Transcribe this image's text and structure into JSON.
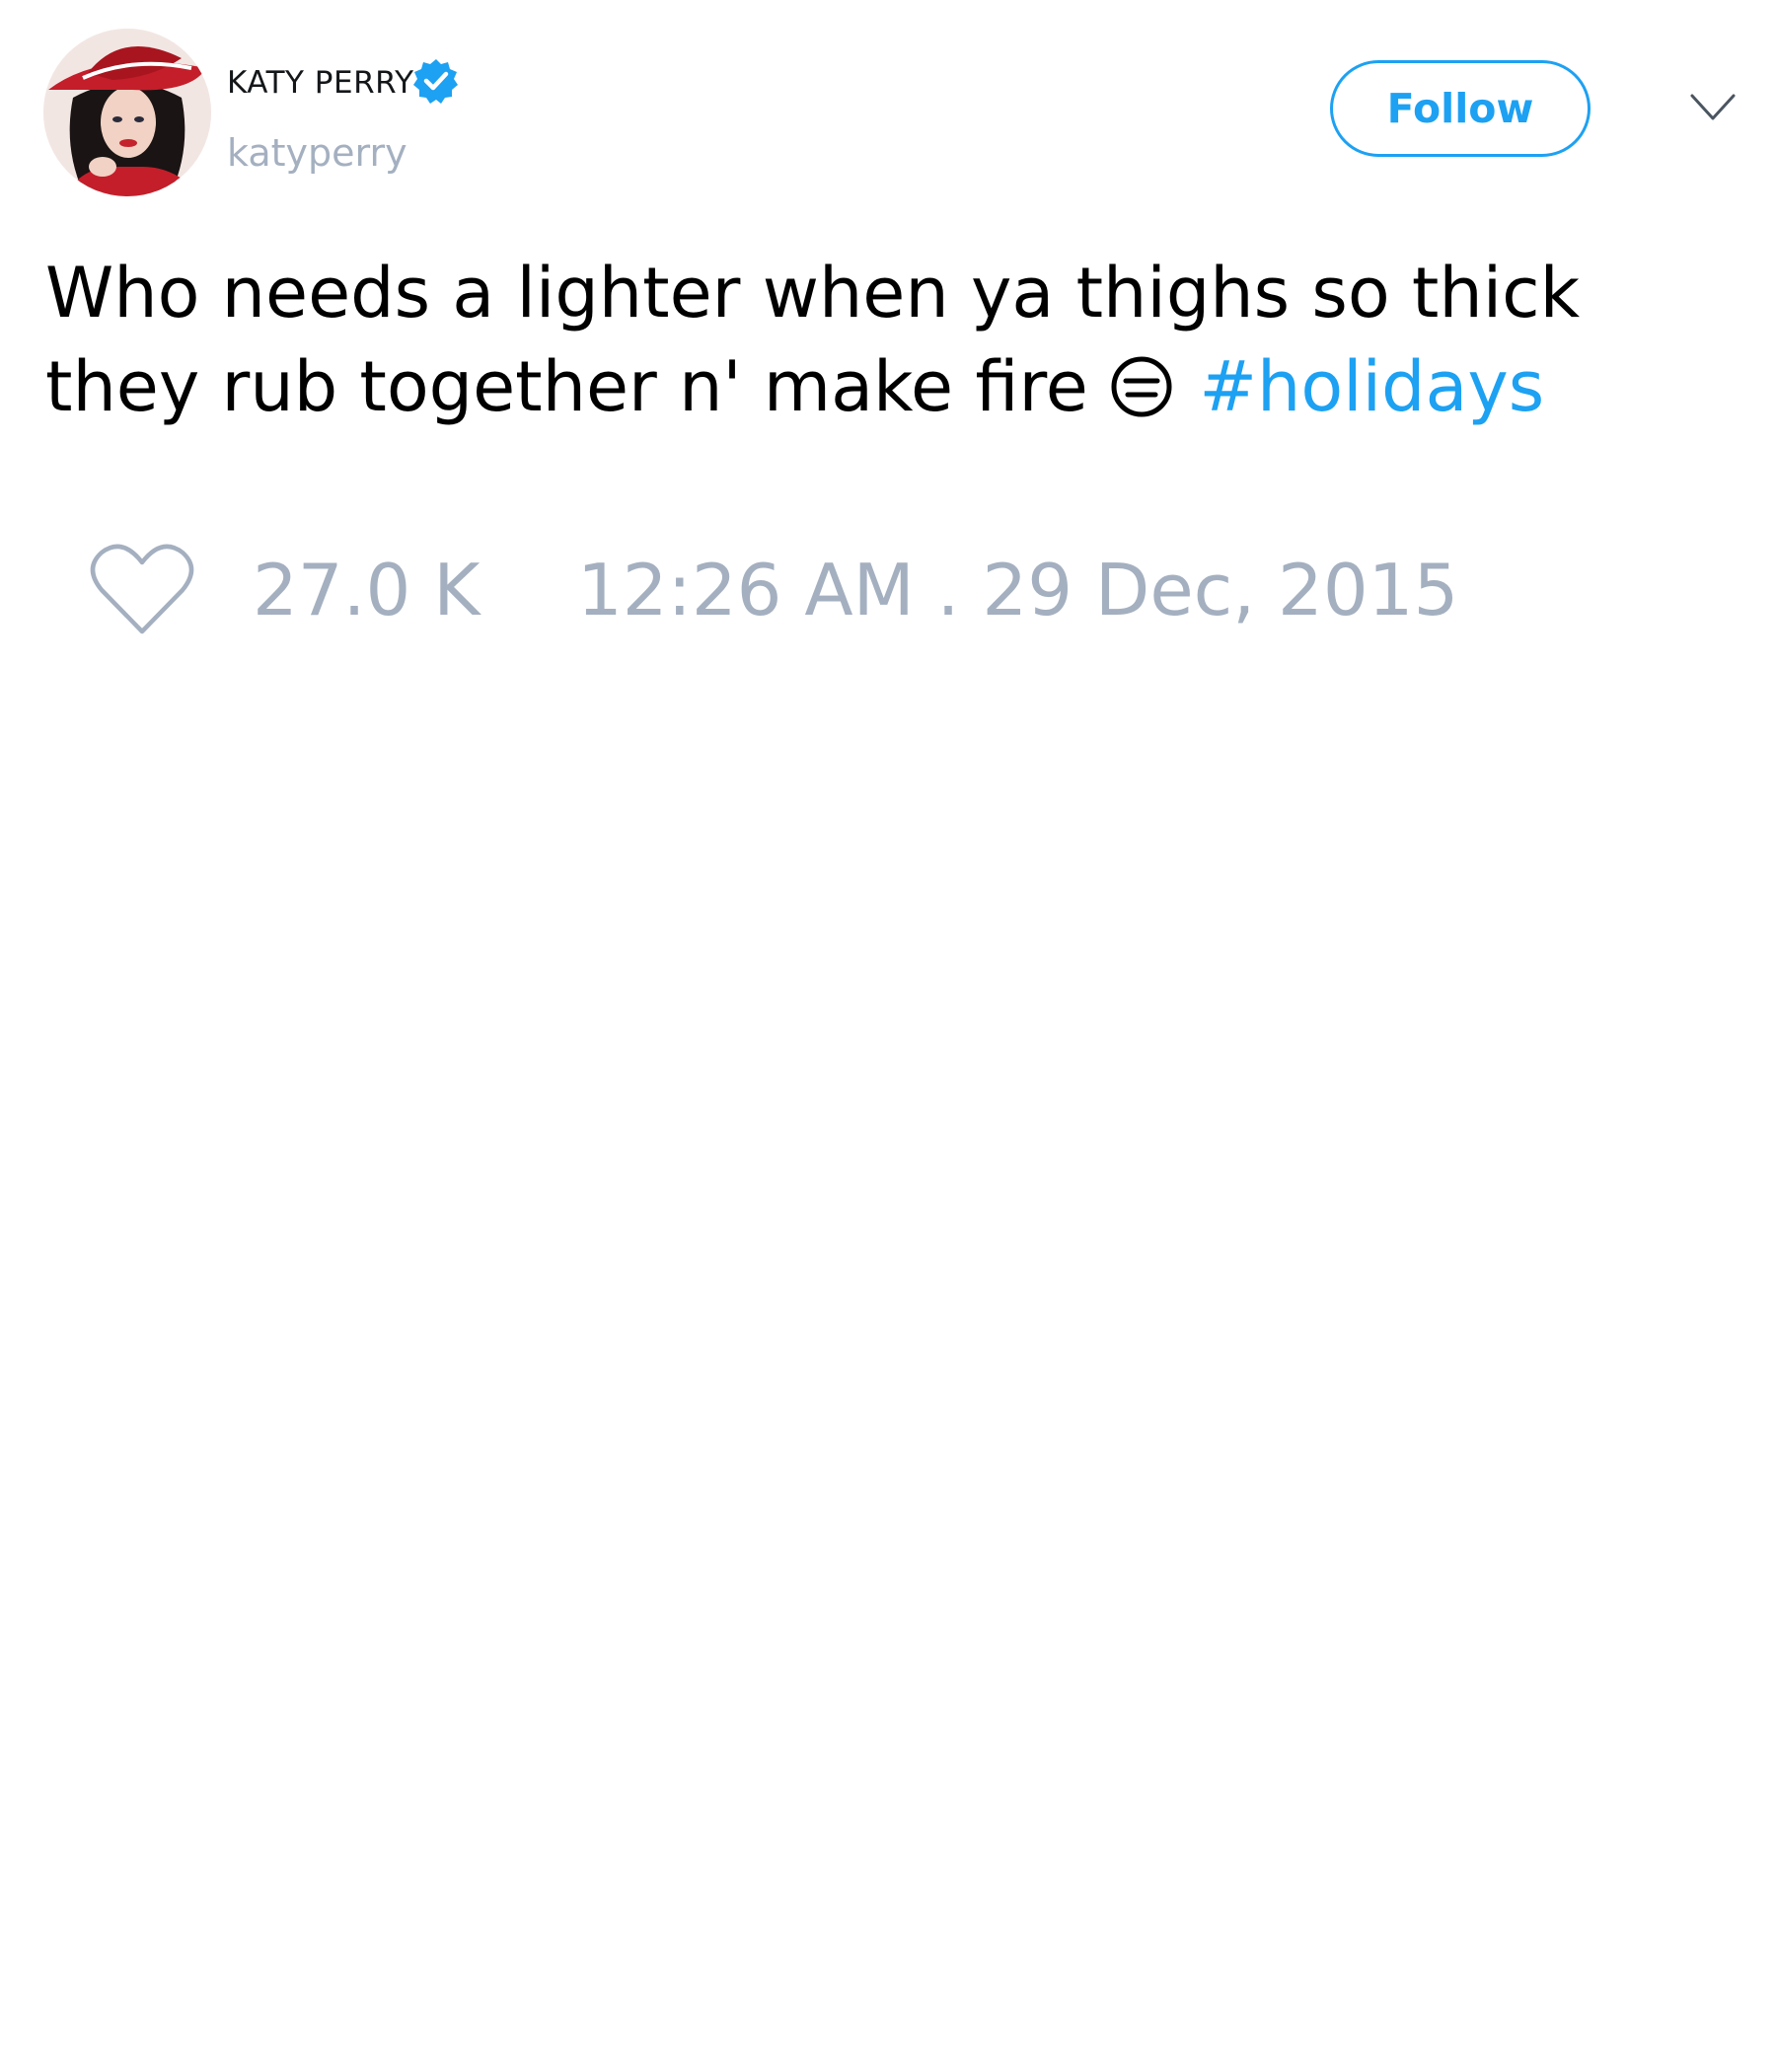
{
  "user": {
    "display_name": "KATY PERRY",
    "handle": "katyperry",
    "verified": true,
    "avatar_icon": "profile-photo"
  },
  "actions": {
    "follow_label": "Follow",
    "menu_icon": "chevron-down-icon"
  },
  "tweet": {
    "text_before": "Who needs a lighter when ya thighs so thick they rub together n' make fire",
    "emoji": "expressionless-face",
    "hashtag": "#holidays"
  },
  "footer": {
    "like_icon": "heart-icon",
    "like_count": "27.0 K",
    "timestamp": "12:26 AM . 29 Dec, 2015"
  },
  "colors": {
    "accent": "#1da1f2",
    "text": "#000000",
    "muted": "#a4b0c0"
  }
}
